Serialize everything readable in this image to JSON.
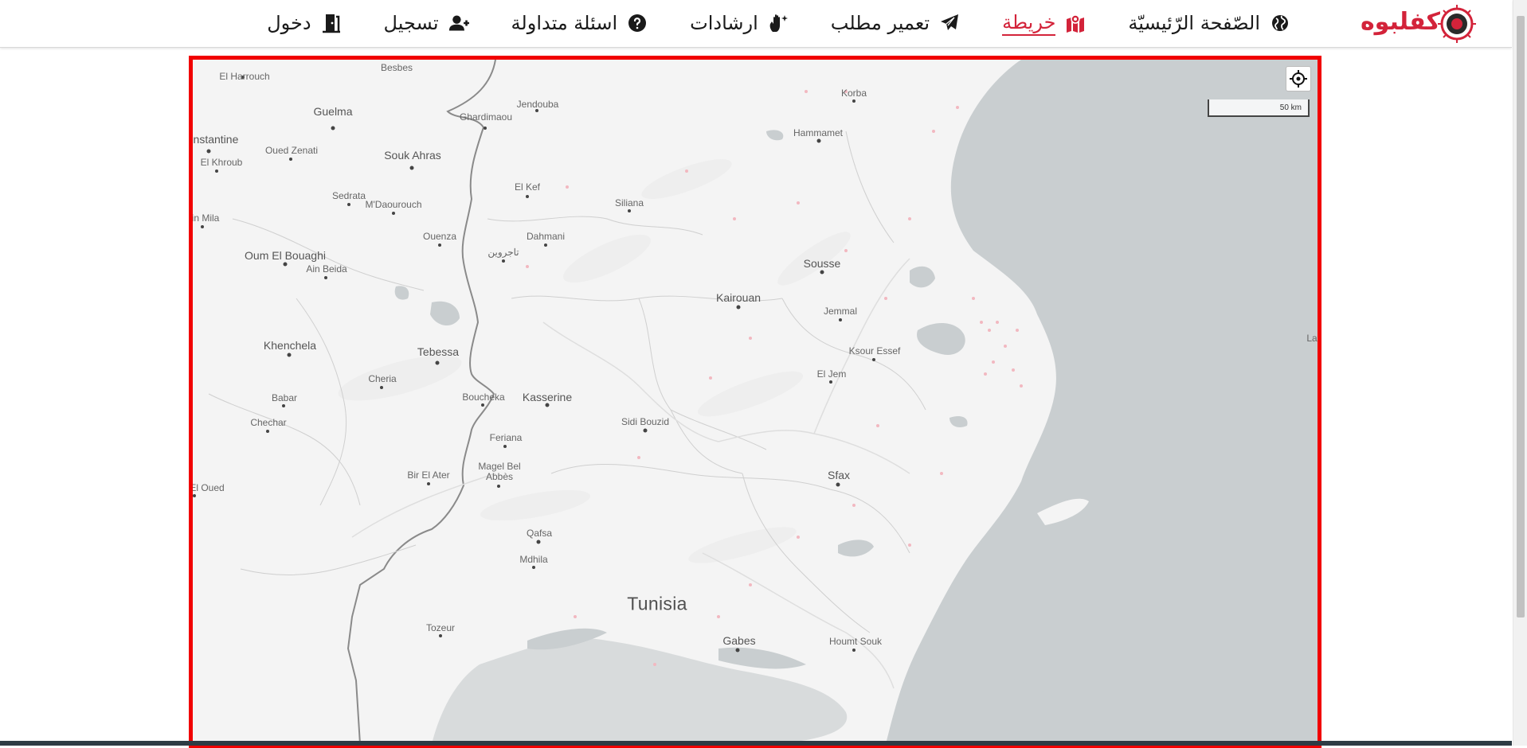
{
  "brand": {
    "name": "كفلبوه",
    "accent_color": "#d3233a"
  },
  "nav": {
    "items": [
      {
        "label": "الصّفحة الرّئيسيّة",
        "icon": "globe-icon",
        "active": false
      },
      {
        "label": "خريطة",
        "icon": "map-marker-icon",
        "active": true
      },
      {
        "label": "تعمير مطلب",
        "icon": "paper-plane-icon",
        "active": false
      },
      {
        "label": "ارشادات",
        "icon": "hand-sparkle-icon",
        "active": false
      },
      {
        "label": "اسئلة متداولة",
        "icon": "question-circle-icon",
        "active": false
      },
      {
        "label": "تسجيل",
        "icon": "user-plus-icon",
        "active": false
      },
      {
        "label": "دخول",
        "icon": "door-enter-icon",
        "active": false
      }
    ]
  },
  "map": {
    "frame_color": "#f10000",
    "scale_label": "50 km",
    "locate_icon": "crosshair-icon",
    "country_label": "Tunisia",
    "places": [
      "Besbes",
      "El Harrouch",
      "Guelma",
      "Ghardimaou",
      "Jendouba",
      "Korba",
      "Hammamet",
      "Constantine",
      "Oued Zenati",
      "Souk Ahras",
      "El Khroub",
      "El Kef",
      "Siliana",
      "Sedrata",
      "M'Daourouch",
      "in Mila",
      "Ouenza",
      "Dahmani",
      "تاجروين",
      "Sousse",
      "Oum El Bouaghi",
      "Ain Beida",
      "Kairouan",
      "Jemmal",
      "Khenchela",
      "Tebessa",
      "Ksour Essef",
      "El Jem",
      "Cheria",
      "Boucheka",
      "Kasserine",
      "Babar",
      "Sidi Bouzid",
      "Chechar",
      "Feriana",
      "Bir El Ater",
      "Magel Bel",
      "Abbès",
      "Sfax",
      "El Oued",
      "Qafsa",
      "Mdhila",
      "Tozeur",
      "Gabes",
      "Houmt Souk",
      "La"
    ]
  }
}
